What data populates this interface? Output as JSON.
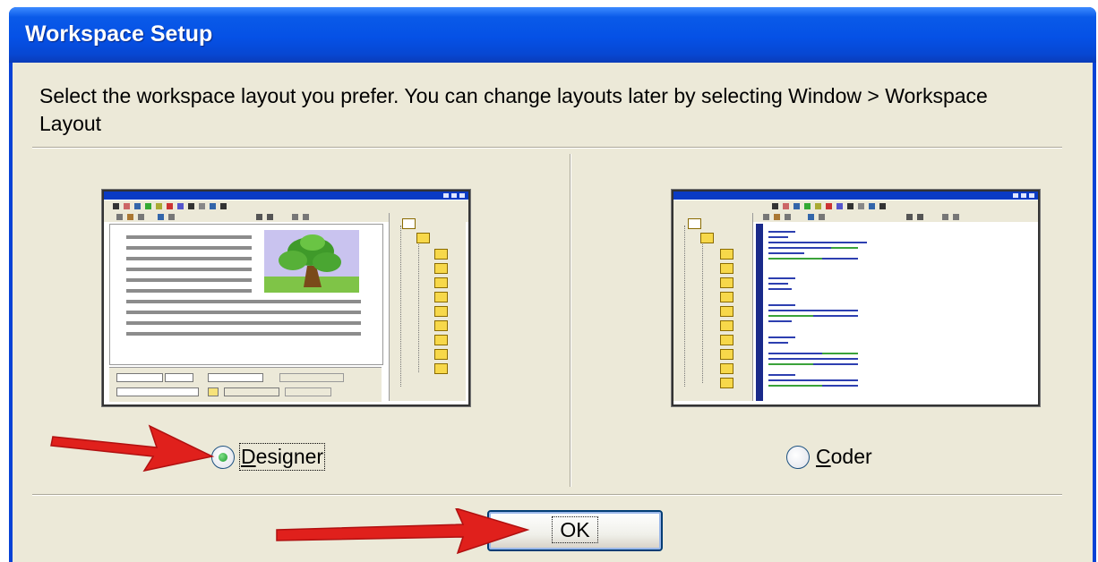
{
  "window": {
    "title": "Workspace Setup"
  },
  "instructions": "Select the workspace layout you prefer. You can change layouts later by selecting Window > Workspace Layout",
  "options": [
    {
      "label_accel": "D",
      "label_rest": "esigner",
      "selected": true
    },
    {
      "label_accel": "C",
      "label_rest": "oder",
      "selected": false
    }
  ],
  "ok_label": "OK",
  "colors": {
    "title_bar": "#0551e6",
    "dialog_bg": "#ece9d8",
    "annotation_arrow": "#e0201c",
    "radio_selected": "#1c9a2c"
  }
}
